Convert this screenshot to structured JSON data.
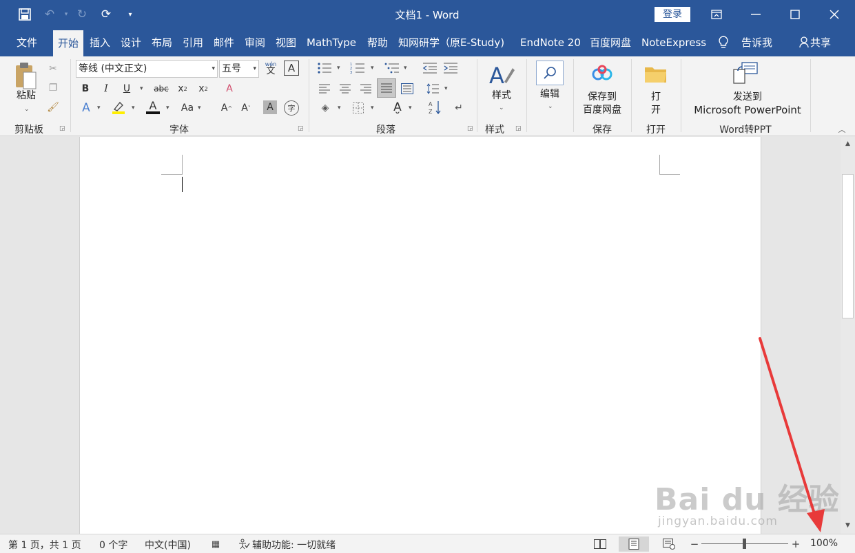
{
  "titlebar": {
    "title": "文档1  -  Word",
    "login_label": "登录"
  },
  "tabs": [
    "文件",
    "开始",
    "插入",
    "设计",
    "布局",
    "引用",
    "邮件",
    "审阅",
    "视图",
    "MathType",
    "帮助",
    "知网研学（原E-Study)",
    "EndNote 20",
    "百度网盘",
    "NoteExpress",
    "告诉我",
    "共享"
  ],
  "ribbon": {
    "clipboard": {
      "paste_label": "粘贴",
      "group_label": "剪贴板"
    },
    "font": {
      "font_name": "等线 (中文正文)",
      "font_size": "五号",
      "phonetic_label": "wén",
      "phonetic_char": "文",
      "group_label": "字体"
    },
    "paragraph": {
      "group_label": "段落"
    },
    "styles": {
      "styles_label": "样式",
      "group_label": "样式"
    },
    "editing": {
      "editing_label": "编辑"
    },
    "save": {
      "line1": "保存到",
      "line2": "百度网盘",
      "group_label": "保存"
    },
    "open": {
      "line1": "打",
      "line2": "开",
      "group_label": "打开"
    },
    "word2ppt": {
      "line1": "发送到",
      "line2": "Microsoft PowerPoint",
      "group_label": "Word转PPT"
    }
  },
  "statusbar": {
    "page_info": "第 1 页，共 1 页",
    "word_count": "0 个字",
    "language": "中文(中国)",
    "accessibility": "辅助功能: 一切就绪",
    "zoom": "100%"
  },
  "watermark": {
    "brand": "Bai du 经验",
    "url": "jingyan.baidu.com"
  },
  "colors": {
    "accent": "#2b579a",
    "ribbon_bg": "#f3f3f3",
    "annotation_arrow": "#e83a3a"
  }
}
